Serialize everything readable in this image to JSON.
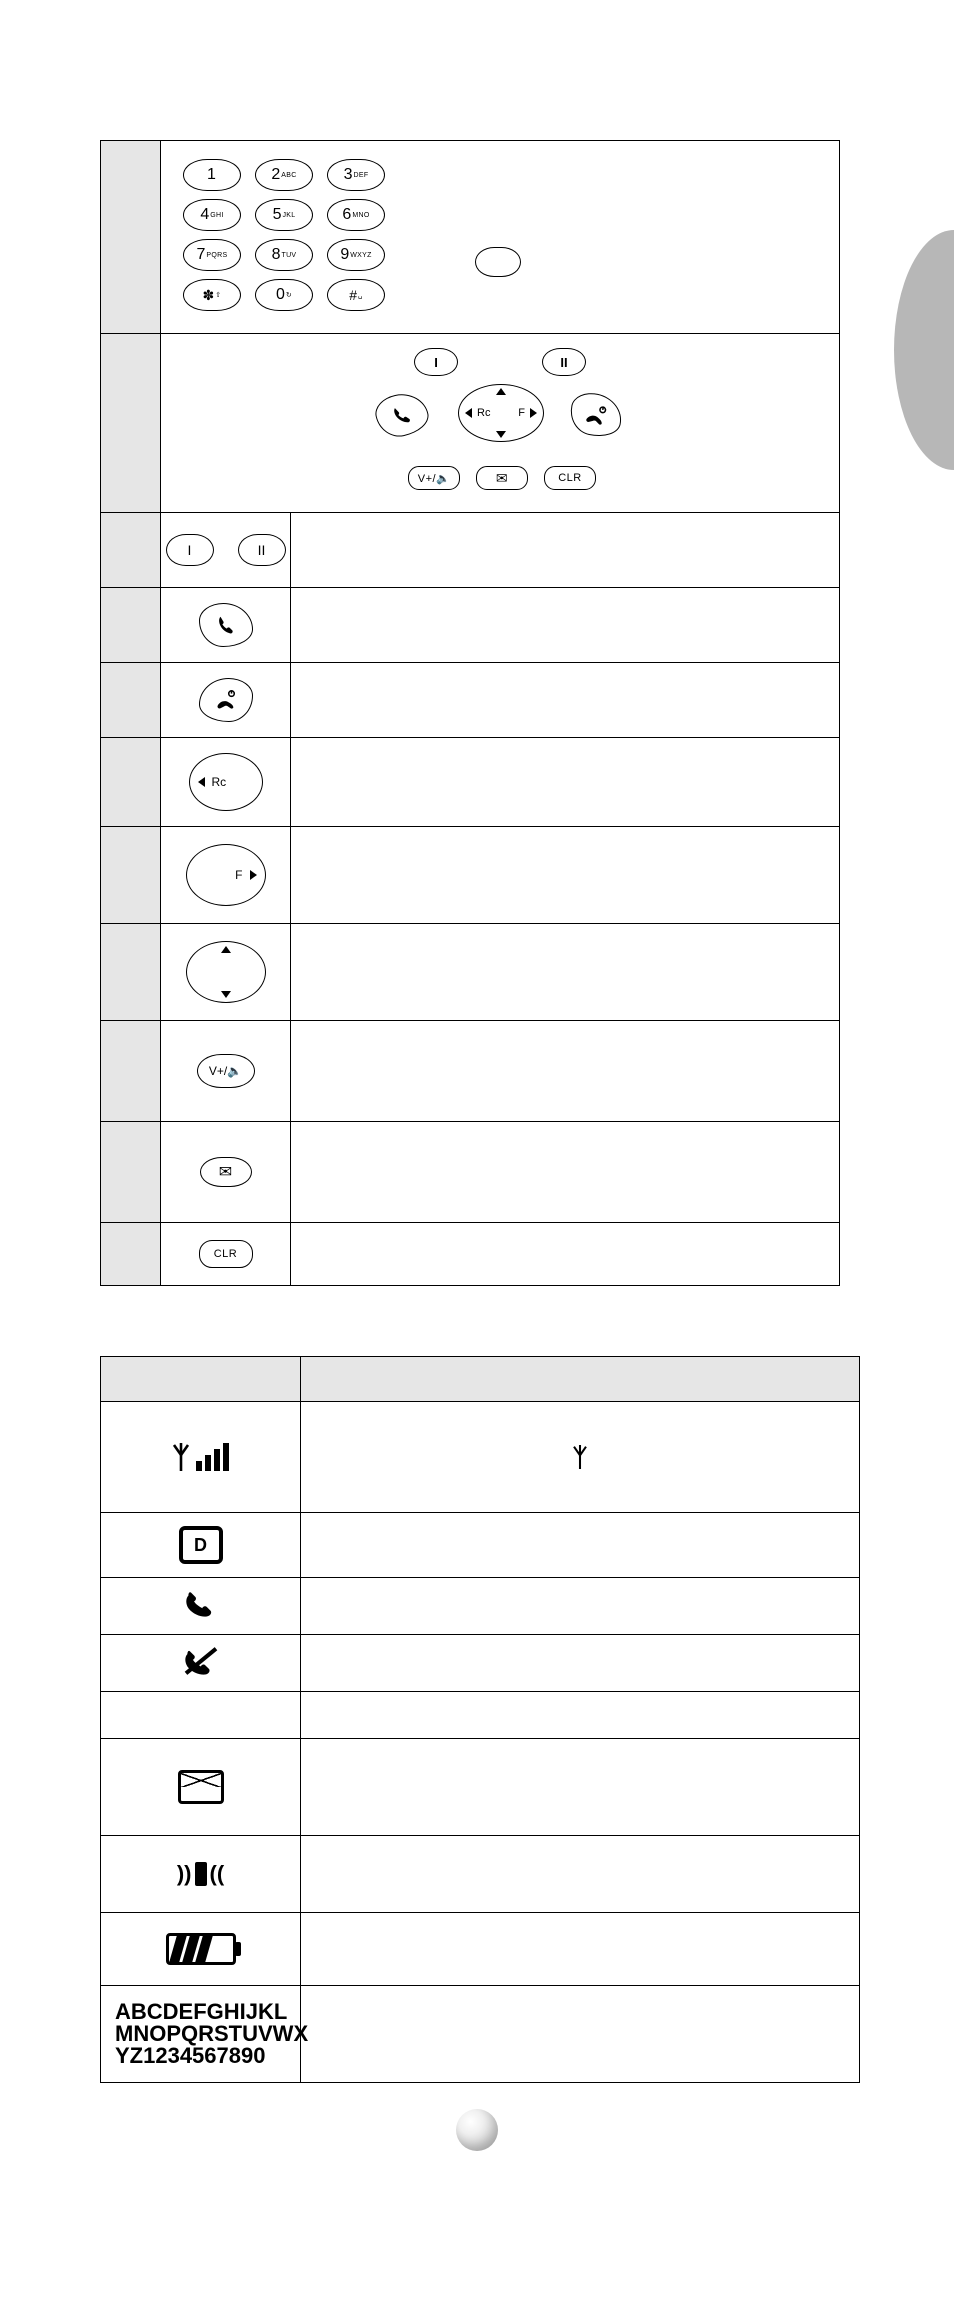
{
  "side_tab": {
    "visible": true
  },
  "keypad_table": {
    "keypad": {
      "keys": [
        {
          "main": "1",
          "sub": ""
        },
        {
          "main": "2",
          "sub": "ABC"
        },
        {
          "main": "3",
          "sub": "DEF"
        },
        {
          "main": "4",
          "sub": "GHI"
        },
        {
          "main": "5",
          "sub": "JKL"
        },
        {
          "main": "6",
          "sub": "MNO"
        },
        {
          "main": "7",
          "sub": "PQRS"
        },
        {
          "main": "8",
          "sub": "TUV"
        },
        {
          "main": "9",
          "sub": "WXYZ"
        },
        {
          "main": "✽",
          "sub": "⇧"
        },
        {
          "main": "0",
          "sub": "↻"
        },
        {
          "main": "#",
          "sub": "␣"
        }
      ],
      "side_key_visible": true
    },
    "controlpad": {
      "softkey1": "I",
      "softkey2": "II",
      "send": "handset",
      "end": "power-handset",
      "nav": {
        "left_label": "Rc",
        "right_label": "F"
      },
      "vol": "V+/🔈",
      "mail": "✉",
      "clr": "CLR"
    },
    "key_rows": [
      {
        "icon": "softkeys",
        "softkey1": "I",
        "softkey2": "II"
      },
      {
        "icon": "send"
      },
      {
        "icon": "end"
      },
      {
        "icon": "nav-left",
        "label": "Rc"
      },
      {
        "icon": "nav-right",
        "label": "F"
      },
      {
        "icon": "nav-updown"
      },
      {
        "icon": "vol",
        "label": "V+/🔈"
      },
      {
        "icon": "mail",
        "label": "✉"
      },
      {
        "icon": "clr",
        "label": "CLR"
      }
    ]
  },
  "display_table": {
    "header": {
      "col1": "",
      "col2": ""
    },
    "rows": [
      {
        "icon": "signal",
        "body_icon": "antenna-small"
      },
      {
        "icon": "d-box",
        "label": "D"
      },
      {
        "icon": "handset"
      },
      {
        "icon": "no-call"
      },
      {
        "icon": "blank"
      },
      {
        "icon": "envelope"
      },
      {
        "icon": "vibrate"
      },
      {
        "icon": "battery"
      },
      {
        "icon": "alpha",
        "lines": [
          "ABCDEFGHIJKL",
          "MNOPQRSTUVWX",
          "YZ1234567890"
        ]
      }
    ]
  }
}
